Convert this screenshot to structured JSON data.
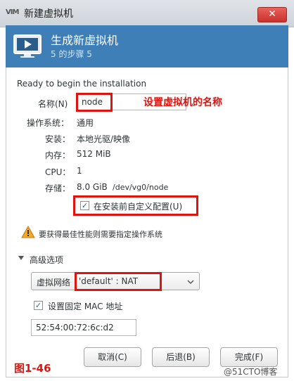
{
  "window": {
    "logo": "VIM",
    "title": "新建虚拟机",
    "close_symbol": "✕"
  },
  "header": {
    "title": "生成新虚拟机",
    "step": "5 的步骤 5"
  },
  "content": {
    "ready_text": "Ready to begin the installation",
    "name_label": "名称(N)",
    "name_value": "node",
    "name_annotation": "设置虚拟机的名称",
    "os_label": "操作系统：",
    "os_value": "通用",
    "install_label": "安装：",
    "install_value": "本地光驱/映像",
    "memory_label": "内存：",
    "memory_value": "512 MiB",
    "cpu_label": "CPU：",
    "cpu_value": "1",
    "storage_label": "存储：",
    "storage_value": "8.0 GiB",
    "storage_path": "/dev/vg0/node",
    "customize_label": "在安装前自定义配置(U)",
    "warning_text": "要获得最佳性能则需要指定操作系统"
  },
  "advanced": {
    "expander_label": "高级选项",
    "network_label": "虚拟网络",
    "network_value": "'default' : NAT",
    "mac_checkbox_label": "设置固定 MAC 地址",
    "mac_value": "52:54:00:72:6c:d2"
  },
  "buttons": {
    "cancel": "取消(C)",
    "back": "后退(B)",
    "finish": "完成(F)"
  },
  "figure_label": "图1-46",
  "watermark": "@51CTO博客",
  "colors": {
    "accent": "#3f7fb8",
    "annotation": "#e0140f"
  }
}
